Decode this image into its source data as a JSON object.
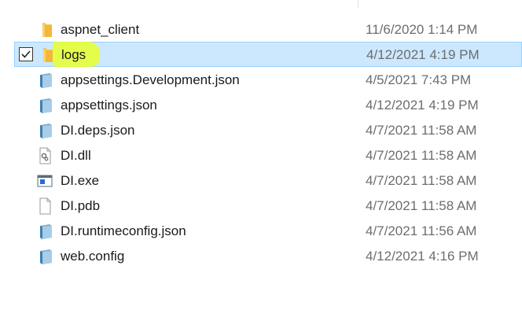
{
  "files": [
    {
      "name": "aspnet_client",
      "modified": "11/6/2020 1:14 PM",
      "icon": "folder-icon",
      "selected": false
    },
    {
      "name": "logs",
      "modified": "4/12/2021 4:19 PM",
      "icon": "folder-icon",
      "selected": true
    },
    {
      "name": "appsettings.Development.json",
      "modified": "4/5/2021 7:43 PM",
      "icon": "json-file-icon",
      "selected": false
    },
    {
      "name": "appsettings.json",
      "modified": "4/12/2021 4:19 PM",
      "icon": "json-file-icon",
      "selected": false
    },
    {
      "name": "DI.deps.json",
      "modified": "4/7/2021 11:58 AM",
      "icon": "json-file-icon",
      "selected": false
    },
    {
      "name": "DI.dll",
      "modified": "4/7/2021 11:58 AM",
      "icon": "dll-file-icon",
      "selected": false
    },
    {
      "name": "DI.exe",
      "modified": "4/7/2021 11:58 AM",
      "icon": "exe-file-icon",
      "selected": false
    },
    {
      "name": "DI.pdb",
      "modified": "4/7/2021 11:58 AM",
      "icon": "blank-file-icon",
      "selected": false
    },
    {
      "name": "DI.runtimeconfig.json",
      "modified": "4/7/2021 11:56 AM",
      "icon": "json-file-icon",
      "selected": false
    },
    {
      "name": "web.config",
      "modified": "4/12/2021 4:16 PM",
      "icon": "json-file-icon",
      "selected": false
    }
  ],
  "colors": {
    "selection_bg": "#cce8ff",
    "selection_border": "#99d1ff",
    "highlighter": "#e8ff2a",
    "folder": "#f7c948",
    "date_text": "#6d6d6d"
  }
}
